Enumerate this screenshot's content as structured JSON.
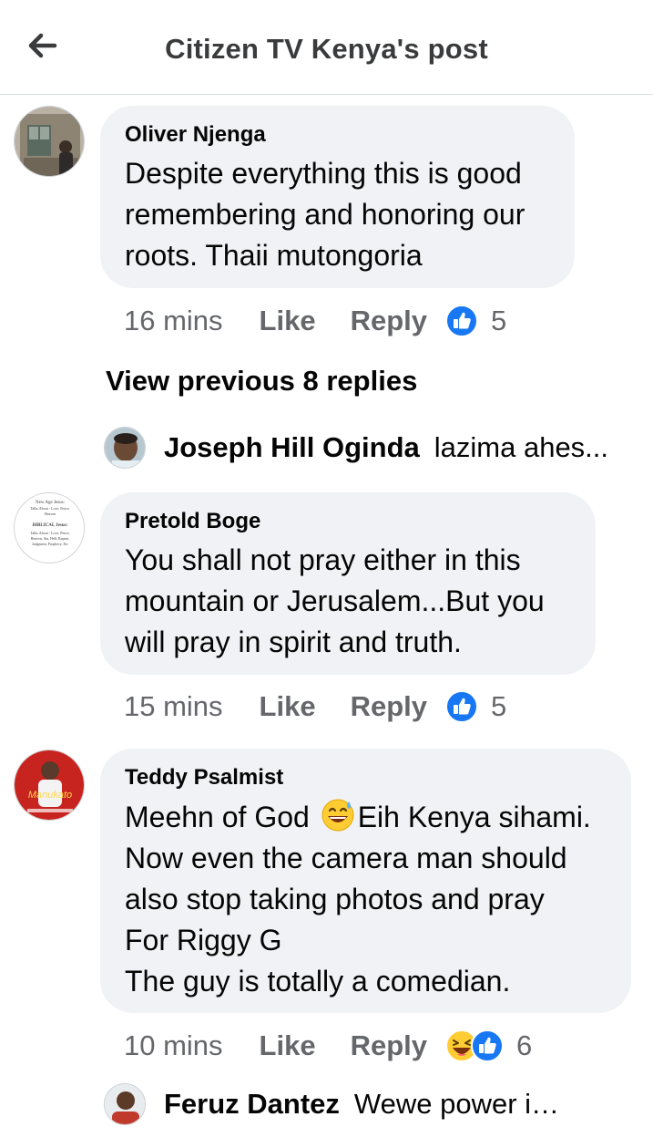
{
  "header": {
    "title": "Citizen TV Kenya's post"
  },
  "comments": [
    {
      "author": "Oliver Njenga",
      "text": "Despite everything this is good\nremembering and honoring our\nroots. Thaii mutongoria",
      "time": "16 mins",
      "like": "Like",
      "reply": "Reply",
      "reaction_count": "5"
    },
    {
      "author": "Pretold Boge",
      "text": "You shall not pray either in this\nmountain or Jerusalem...But you\nwill pray in spirit and truth.",
      "time": "15 mins",
      "like": "Like",
      "reply": "Reply",
      "reaction_count": "5",
      "avatar_text": {
        "l1": "New Age Jesus:",
        "l2": "Talks About - Love, Peace,",
        "l3": "Heaven",
        "l4": "BIBLICAL Jesus:",
        "l5": "Talks About - Love, Peace,",
        "l6": "Heaven, Sin, Hell, Repent,",
        "l7": "Judgment, Prophecy, Etc"
      }
    },
    {
      "author": "Teddy Psalmist",
      "text_a": "Meehn of God ",
      "text_b": "Eih Kenya sihami.\nNow even the camera man should\nalso stop taking photos and pray\nFor Riggy G\nThe guy is totally a comedian.",
      "time": "10 mins",
      "like": "Like",
      "reply": "Reply",
      "reaction_count": "6",
      "avatar_text": "Manukato"
    }
  ],
  "view_previous": "View previous 8 replies",
  "replies": [
    {
      "name": "Joseph Hill Oginda",
      "text": "lazima ahes..."
    },
    {
      "name": "Feruz Dantez",
      "text": "Wewe power ime..."
    }
  ],
  "icons": {
    "back": "arrow-left-icon",
    "like": "thumbs-up-icon",
    "haha": "laughing-face-icon",
    "sweat": "grinning-sweat-face-icon"
  },
  "colors": {
    "like_blue": "#1877f2",
    "bubble": "#f0f2f5",
    "meta": "#65676b"
  }
}
